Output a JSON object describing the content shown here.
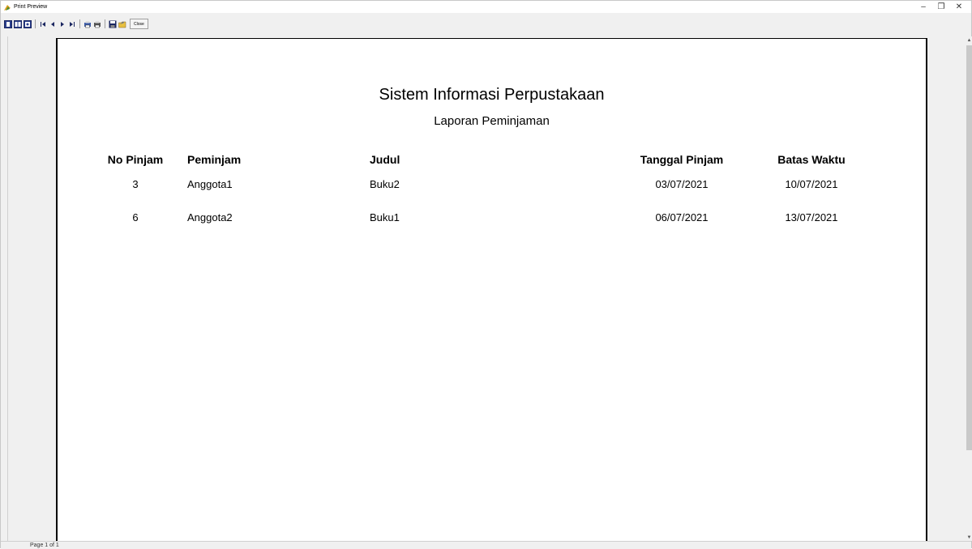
{
  "window": {
    "title": "Print Preview",
    "controls": {
      "minimize": "–",
      "maximize": "❐",
      "close": "✕"
    }
  },
  "toolbar": {
    "close_label": "Close",
    "buttons": [
      "one-page-icon",
      "two-page-icon",
      "zoom-icon",
      "first-page-icon",
      "prev-page-icon",
      "next-page-icon",
      "last-page-icon",
      "print-setup-icon",
      "print-icon",
      "save-icon",
      "open-icon"
    ]
  },
  "report": {
    "title": "Sistem Informasi Perpustakaan",
    "subtitle": "Laporan Peminjaman",
    "columns": {
      "no": "No Pinjam",
      "peminjam": "Peminjam",
      "judul": "Judul",
      "tanggal": "Tanggal Pinjam",
      "batas": "Batas Waktu"
    },
    "rows": [
      {
        "no": "3",
        "peminjam": "Anggota1",
        "judul": "Buku2",
        "tanggal": "03/07/2021",
        "batas": "10/07/2021"
      },
      {
        "no": "6",
        "peminjam": "Anggota2",
        "judul": "Buku1",
        "tanggal": "06/07/2021",
        "batas": "13/07/2021"
      }
    ]
  },
  "statusbar": {
    "page": "Page 1 of 1"
  }
}
